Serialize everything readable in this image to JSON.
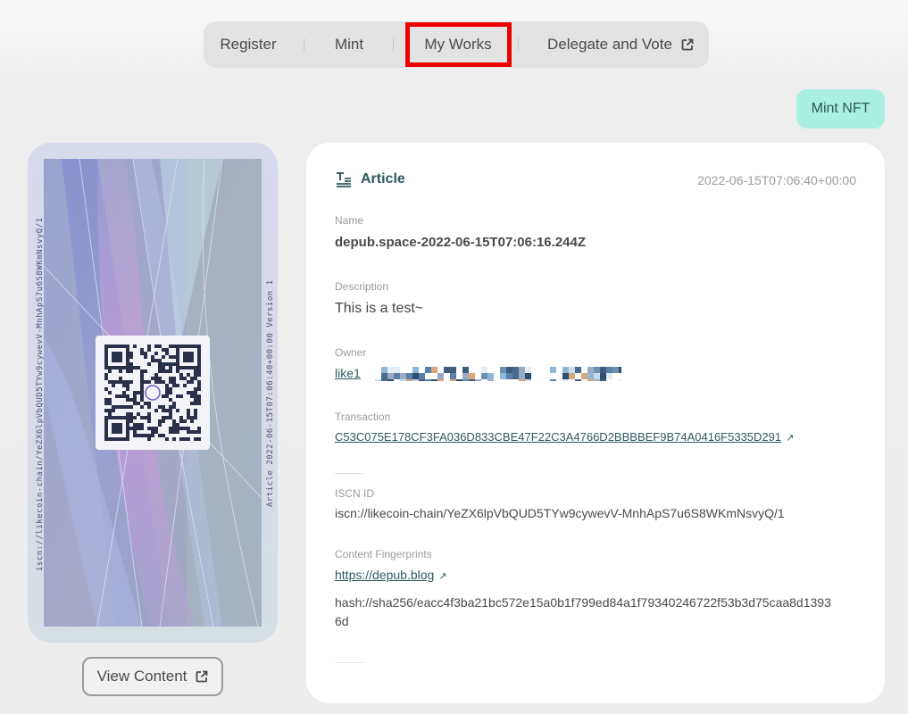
{
  "nav": {
    "items": [
      {
        "label": "Register"
      },
      {
        "label": "Mint"
      },
      {
        "label": "My Works"
      },
      {
        "label": "Delegate and Vote"
      }
    ]
  },
  "mint_nft_label": "Mint NFT",
  "card": {
    "side_left_text": "iscn://likecoin-chain/YeZX6lpVbQUD5TYw9cywevV-MnhApS7u6S8WKmNsvyQ/1",
    "side_right_text": "Article 2022-06-15T07:06:40+00:00 Version 1",
    "view_content_label": "View Content"
  },
  "record": {
    "type": "Article",
    "timestamp": "2022-06-15T07:06:40+00:00",
    "name_label": "Name",
    "name": "depub.space-2022-06-15T07:06:16.244Z",
    "description_label": "Description",
    "description": "This is a test~",
    "owner_label": "Owner",
    "owner": "like1",
    "transaction_label": "Transaction",
    "transaction": "C53C075E178CF3FA036D833CBE47F22C3A4766D2BBBBEF9B74A0416F5335D291",
    "iscn_label": "ISCN ID",
    "iscn_id": "iscn://likecoin-chain/YeZX6lpVbQUD5TYw9cywevV-MnhApS7u6S8WKmNsvyQ/1",
    "fingerprints_label": "Content Fingerprints",
    "fingerprint_url": "https://depub.blog",
    "fingerprint_hash_1": "hash://sha256/eacc4f3ba21bc572e15a0b1f799ed84a1f79340246722f53b3d75caa8d1393",
    "fingerprint_hash_2": "6d"
  },
  "colors": {
    "accent": "#2e5a5e",
    "mint_button": "#aaf0e1",
    "highlight": "#ec0000"
  }
}
